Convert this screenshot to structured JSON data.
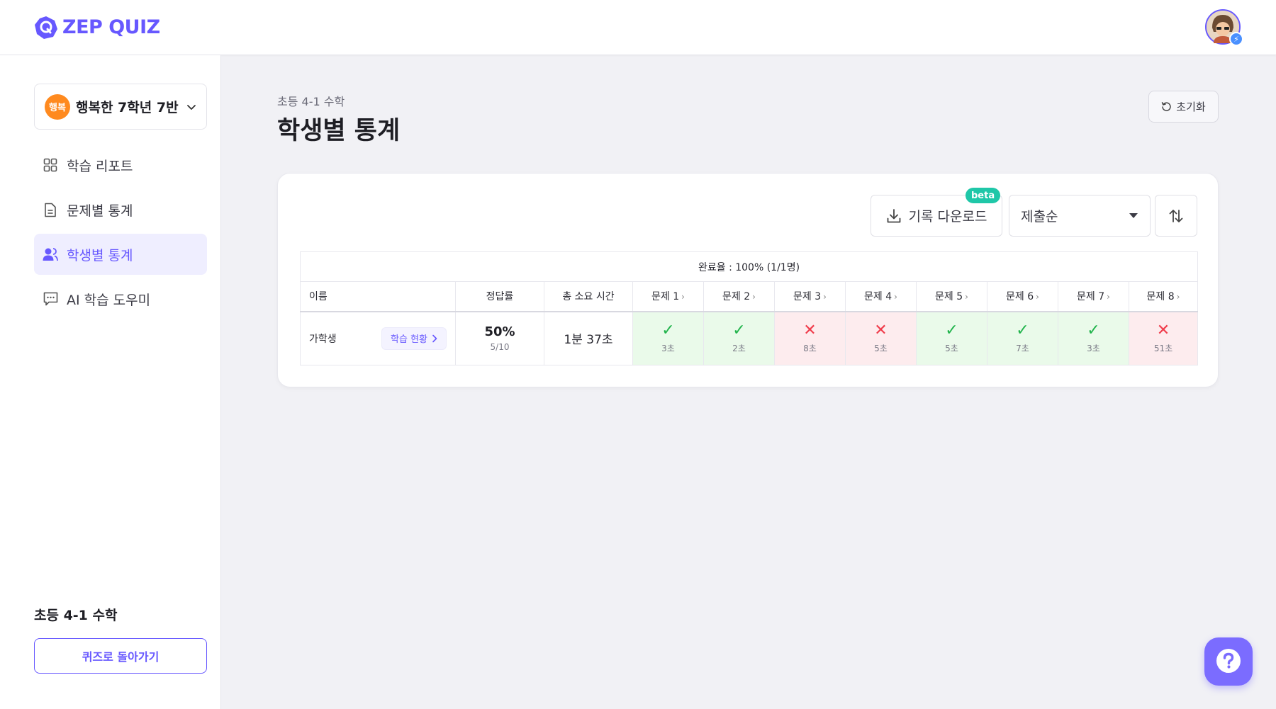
{
  "header": {
    "logo_text": "ZEP QUIZ"
  },
  "sidebar": {
    "class_badge": "행복",
    "class_name": "행복한 7학년 7반",
    "nav": [
      {
        "label": "학습 리포트",
        "icon": "grid-icon",
        "active": false
      },
      {
        "label": "문제별 통계",
        "icon": "document-icon",
        "active": false
      },
      {
        "label": "학생별 통계",
        "icon": "user-icon",
        "active": true
      },
      {
        "label": "AI 학습 도우미",
        "icon": "chat-icon",
        "active": false
      }
    ],
    "course_name": "초등 4-1 수학",
    "back_button": "퀴즈로 돌아가기"
  },
  "main": {
    "breadcrumb": "초등 4-1 수학",
    "title": "학생별 통계",
    "reset_button": "초기화"
  },
  "toolbar": {
    "download_label": "기록 다운로드",
    "beta_badge": "beta",
    "sort_selected": "제출순"
  },
  "table": {
    "completion": "완료율 : 100% (1/1명)",
    "headers": {
      "name": "이름",
      "rate": "정답률",
      "time": "총 소요 시간",
      "questions": [
        "문제 1",
        "문제 2",
        "문제 3",
        "문제 4",
        "문제 5",
        "문제 6",
        "문제 7",
        "문제 8"
      ]
    },
    "rows": [
      {
        "name": "가학생",
        "status_button": "학습 현황",
        "rate": "50%",
        "rate_detail": "5/10",
        "total_time": "1분 37초",
        "answers": [
          {
            "correct": true,
            "time": "3초"
          },
          {
            "correct": true,
            "time": "2초"
          },
          {
            "correct": false,
            "time": "8초"
          },
          {
            "correct": false,
            "time": "5초"
          },
          {
            "correct": true,
            "time": "5초"
          },
          {
            "correct": true,
            "time": "7초"
          },
          {
            "correct": true,
            "time": "3초"
          },
          {
            "correct": false,
            "time": "51초"
          }
        ]
      }
    ]
  },
  "colors": {
    "brand": "#6758ff",
    "correct": "#1fb34a",
    "incorrect": "#f03c4b",
    "beta": "#1fc7a8",
    "class_badge": "#ff8a1f"
  }
}
